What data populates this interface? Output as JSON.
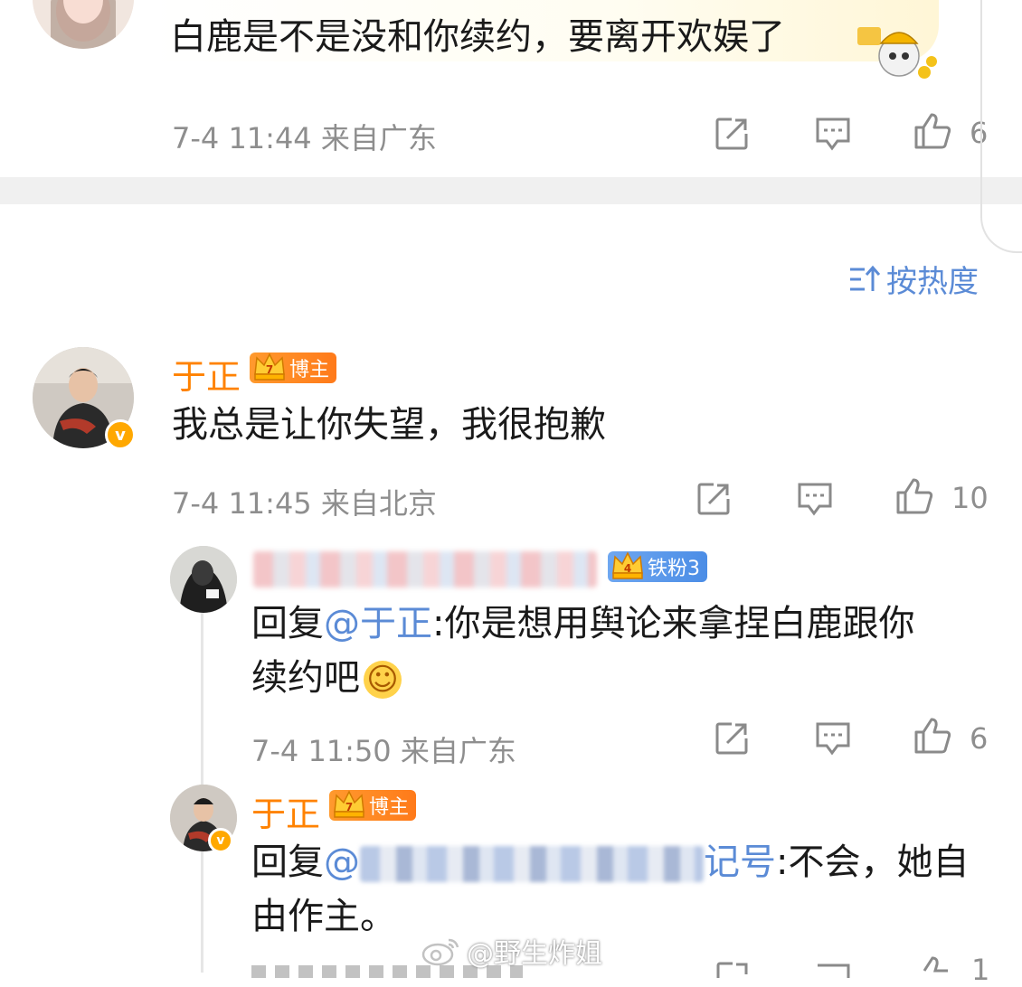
{
  "top_comment": {
    "text": "白鹿是不是没和你续约，要离开欢娱了",
    "meta": "7-4 11:44 来自广东",
    "likes": "6"
  },
  "sort_label": "按热度",
  "comment": {
    "author": "于正",
    "badge": "博主",
    "text": "我总是让你失望，我很抱歉",
    "meta": "7-4 11:45 来自北京",
    "likes": "10",
    "verified_mark": "v"
  },
  "reply1": {
    "badge": "铁粉3",
    "prefix": "回复",
    "mention": "@于正",
    "text": ":你是想用舆论来拿捏白鹿跟你",
    "text2": "续约吧",
    "emoji": "☺",
    "meta": "7-4 11:50 来自广东",
    "likes": "6"
  },
  "reply2": {
    "author": "于正",
    "badge": "博主",
    "prefix": "回复",
    "mention_start": "@",
    "mention_end": "记号",
    "text": ":不会，她自",
    "text2": "由作主。",
    "likes": "1"
  },
  "watermark": "@野生炸姐",
  "colors": {
    "orange": "#ff8200",
    "blue": "#5b8bd6",
    "meta_gray": "#8e8e8e",
    "divider": "#f0f0f0"
  }
}
